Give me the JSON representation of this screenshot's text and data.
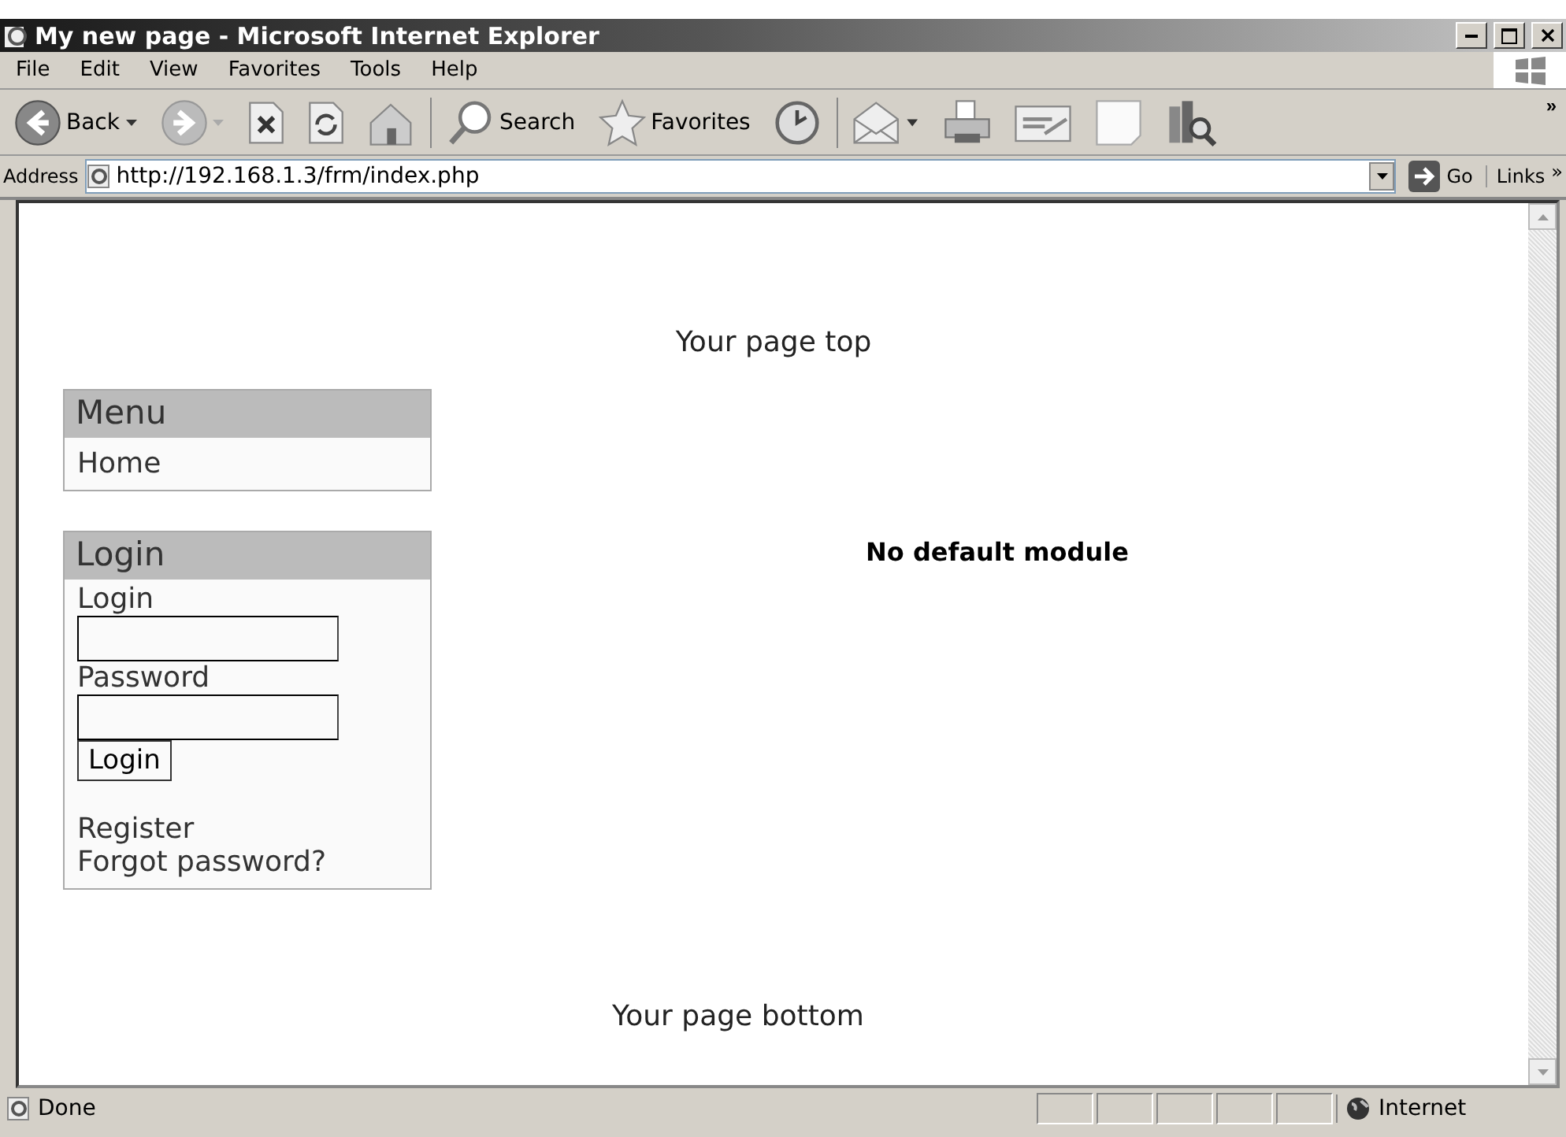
{
  "window": {
    "title": "My new page - Microsoft Internet Explorer"
  },
  "menu_bar": [
    {
      "label": "File"
    },
    {
      "label": "Edit"
    },
    {
      "label": "View"
    },
    {
      "label": "Favorites"
    },
    {
      "label": "Tools"
    },
    {
      "label": "Help"
    }
  ],
  "toolbar": [
    {
      "kind": "back",
      "label": "Back"
    },
    {
      "kind": "forward"
    },
    {
      "kind": "stop"
    },
    {
      "kind": "refresh"
    },
    {
      "kind": "home"
    },
    {
      "kind": "separator"
    },
    {
      "kind": "search",
      "label": "Search"
    },
    {
      "kind": "favorites",
      "label": "Favorites"
    },
    {
      "kind": "history"
    },
    {
      "kind": "separator"
    },
    {
      "kind": "mail"
    },
    {
      "kind": "print"
    },
    {
      "kind": "edit"
    },
    {
      "kind": "note"
    },
    {
      "kind": "research"
    }
  ],
  "toolbar_more": "»",
  "address_bar": {
    "label": "Address",
    "value": "http://192.168.1.3/frm/index.php",
    "go": "Go",
    "links": "Links",
    "links_more": "»"
  },
  "page": {
    "top": "Your page top",
    "menu_box": {
      "title": "Menu",
      "items": [
        "Home"
      ]
    },
    "login_box": {
      "title": "Login",
      "fields": [
        {
          "label": "Login"
        },
        {
          "label": "Password"
        }
      ],
      "button": "Login",
      "links": [
        "Register",
        "Forgot password?"
      ]
    },
    "main": "No default module",
    "bottom": "Your page bottom"
  },
  "status_bar": {
    "text": "Done",
    "zone": "Internet"
  }
}
